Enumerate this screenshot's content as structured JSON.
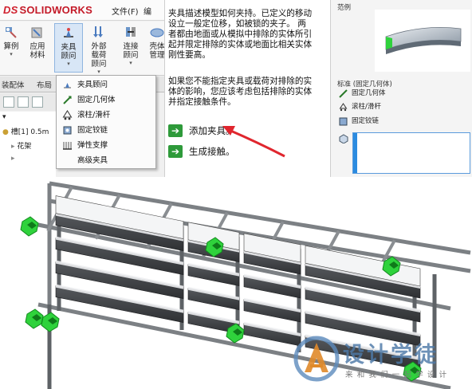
{
  "app": {
    "logo_ds": "DS",
    "logo_text": "SOLIDWORKS",
    "menu": [
      "文件(F)",
      "编"
    ]
  },
  "ribbon": {
    "buttons": [
      {
        "label": "算例"
      },
      {
        "label": "应用材料"
      },
      {
        "label": "夹具顾问"
      },
      {
        "label": "外部载荷顾问"
      },
      {
        "label": "连接顾问"
      },
      {
        "label": "壳体管理"
      }
    ]
  },
  "tabs": [
    "装配体",
    "布局"
  ],
  "tree": {
    "row1": "槽[1] 0.5m",
    "row2": "花架"
  },
  "fixture_menu": {
    "items": [
      {
        "label": "夹具顾问",
        "icon": "fixture-advisor-icon"
      },
      {
        "label": "固定几何体",
        "icon": "fixed-geometry-icon"
      },
      {
        "label": "滚柱/滑杆",
        "icon": "roller-slider-icon"
      },
      {
        "label": "固定铰链",
        "icon": "fixed-hinge-icon"
      },
      {
        "label": "弹性支撑",
        "icon": "elastic-support-icon"
      },
      {
        "label": "高级夹具",
        "icon": ""
      }
    ]
  },
  "help": {
    "para1": [
      "夹具描述模型如何夹持。已定义的移动",
      "设立一般定位移，如被锁的夹子。 两",
      "者都由地面或从模拟中排除的实体所引",
      "起并限定排除的实体或地面比相关实体",
      "刚性要高。"
    ],
    "para2": [
      "如果您不能指定夹具或载荷对排除的实",
      "体的影响，您应该考虑包括排除的实体",
      "并指定接触条件。"
    ],
    "add_fixture": "添加夹具。",
    "gen_contact": "生成接触。"
  },
  "property_manager": {
    "section_title": "范例",
    "list_title": "标准 (固定几何体)",
    "items": [
      "固定几何体",
      "滚柱/滑杆",
      "固定铰链"
    ]
  },
  "watermark": {
    "title": "设计学徒",
    "subtitle": "来和我们一起学设计"
  },
  "colors": {
    "accent_red": "#d0202e",
    "fixture_green": "#2fd23c",
    "wm_blue": "#4e7aa8"
  }
}
